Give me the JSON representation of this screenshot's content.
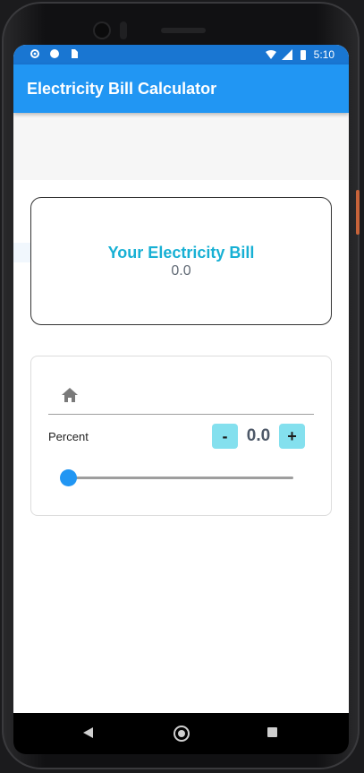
{
  "status_bar": {
    "time": "5:10",
    "left_icons": [
      "settings-icon",
      "sync-icon",
      "sim-card-icon"
    ],
    "right_icons": [
      "wifi-icon",
      "signal-icon",
      "battery-icon"
    ]
  },
  "app_bar": {
    "title": "Electricity Bill Calculator",
    "color": "#2196f3",
    "status_color": "#1976d2"
  },
  "bill_card": {
    "label": "Your Electricity Bill",
    "value": "0.0",
    "label_color": "#17b0d4"
  },
  "input_card": {
    "field_icon": "home-icon",
    "percent_label": "Percent",
    "stepper": {
      "minus_label": "-",
      "value": "0.0",
      "plus_label": "+",
      "button_color": "#84e0ee"
    },
    "slider": {
      "value": 0.0,
      "thumb_color": "#2196f3"
    }
  },
  "nav_bar": {
    "icons": [
      "back-icon",
      "home-nav-icon",
      "recent-apps-icon"
    ]
  }
}
